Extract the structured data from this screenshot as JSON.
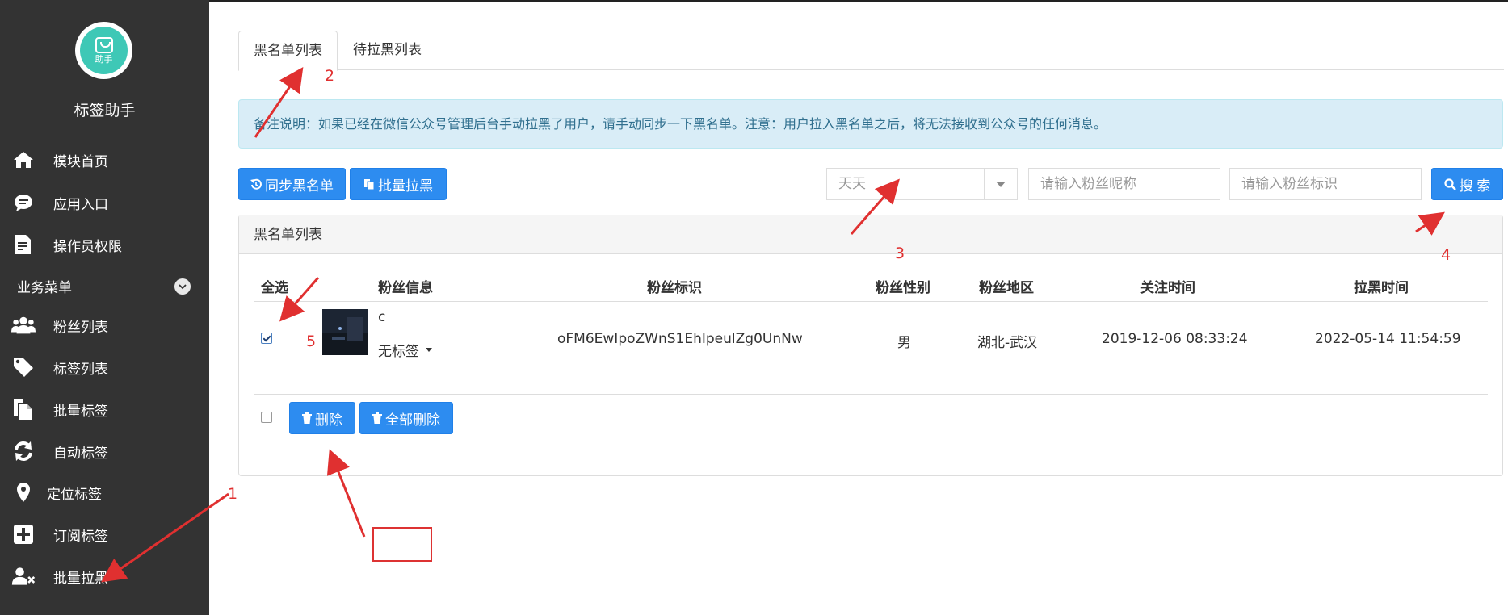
{
  "sidebar": {
    "logo_text": "助手",
    "brand": "标签助手",
    "top_items": [
      {
        "label": "模块首页",
        "icon": "home-icon"
      },
      {
        "label": "应用入口",
        "icon": "chat-icon"
      },
      {
        "label": "操作员权限",
        "icon": "document-edit-icon"
      }
    ],
    "section_label": "业务菜单",
    "items": [
      {
        "label": "粉丝列表",
        "icon": "users-icon"
      },
      {
        "label": "标签列表",
        "icon": "tag-icon"
      },
      {
        "label": "批量标签",
        "icon": "copy-icon"
      },
      {
        "label": "自动标签",
        "icon": "refresh-icon"
      },
      {
        "label": "定位标签",
        "icon": "map-pin-icon"
      },
      {
        "label": "订阅标签",
        "icon": "plus-square-icon"
      },
      {
        "label": "批量拉黑",
        "icon": "user-remove-icon"
      }
    ]
  },
  "tabs": [
    {
      "label": "黑名单列表",
      "active": true
    },
    {
      "label": "待拉黑列表",
      "active": false
    }
  ],
  "alert": "备注说明：如果已经在微信公众号管理后台手动拉黑了用户，请手动同步一下黑名单。注意：用户拉入黑名单之后，将无法接收到公众号的任何消息。",
  "toolbar": {
    "sync_label": "同步黑名单",
    "batch_label": "批量拉黑",
    "select_value": "天天",
    "nickname_placeholder": "请输入粉丝昵称",
    "tag_placeholder": "请输入粉丝标识",
    "search_label": "搜 索"
  },
  "panel": {
    "title": "黑名单列表",
    "columns": [
      "全选",
      "粉丝信息",
      "粉丝标识",
      "粉丝性别",
      "粉丝地区",
      "关注时间",
      "拉黑时间"
    ],
    "rows": [
      {
        "checked": true,
        "name": "c",
        "tag": "无标签",
        "openid": "oFM6EwIpoZWnS1EhIpeulZg0UnNw",
        "gender": "男",
        "region": "湖北-武汉",
        "follow_time": "2019-12-06 08:33:24",
        "block_time": "2022-05-14 11:54:59"
      }
    ],
    "delete_label": "删除",
    "delete_all_label": "全部删除"
  },
  "annotations": [
    "1",
    "2",
    "3",
    "4",
    "5"
  ],
  "colors": {
    "sidebar": "#333333",
    "primary": "#2d8cf0",
    "annotation": "#e03030",
    "alert_bg": "#d9edf7"
  }
}
